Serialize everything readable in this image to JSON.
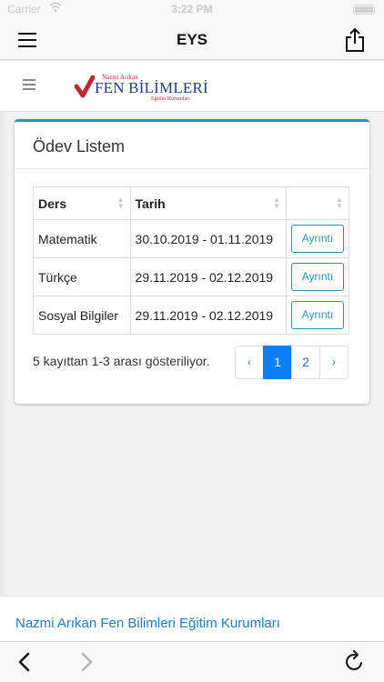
{
  "status_bar": {
    "carrier": "Carrier",
    "time": "3:22 PM"
  },
  "app": {
    "title": "EYS"
  },
  "logo": {
    "top": "Nazmi Arıkan",
    "main": "FEN BİLİMLERİ",
    "sub": "Eğitim Kurumları"
  },
  "card": {
    "title": "Ödev Listem",
    "columns": [
      "Ders",
      "Tarih",
      ""
    ],
    "rows": [
      {
        "ders": "Matematik",
        "tarih": "30.10.2019 - 01.11.2019",
        "action": "Ayrıntı"
      },
      {
        "ders": "Türkçe",
        "tarih": "29.11.2019 - 02.12.2019",
        "action": "Ayrıntı"
      },
      {
        "ders": "Sosyal Bilgiler",
        "tarih": "29.11.2019 - 02.12.2019",
        "action": "Ayrıntı"
      }
    ],
    "info": "5 kayıttan 1-3 arası gösteriliyor.",
    "pagination": {
      "prev": "‹",
      "pages": [
        "1",
        "2"
      ],
      "active_page": "1",
      "next": "›"
    }
  },
  "footer": {
    "link": "Nazmi Arıkan Fen Bilimleri Eğitim Kurumları"
  },
  "colors": {
    "accent": "#1d9bb5",
    "active_page": "#0f7ef4",
    "link": "#1f7abf",
    "logo_red": "#c0272d",
    "logo_blue": "#1f3c88"
  },
  "icons": [
    "menu-icon",
    "share-icon",
    "hamburger-icon",
    "back-arrow-icon",
    "forward-arrow-icon",
    "reload-icon"
  ]
}
